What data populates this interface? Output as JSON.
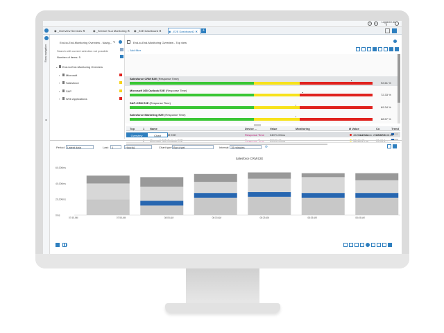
{
  "app": {
    "user_label": "Logged in as",
    "user_name": "ti"
  },
  "tabs": [
    {
      "label": "_Overview Services"
    },
    {
      "label": "_Service SLA Monitoring"
    },
    {
      "label": "_E2E Dashboard"
    },
    {
      "label": "_E2E Dashboard2"
    }
  ],
  "sidebar": {
    "title": "End-to-End-Monitoring Overview - Navig...",
    "search_placeholder": "Search with current selection not possible",
    "items_label": "Number of items:",
    "items_count": "5",
    "tree": [
      {
        "label": "End-to-End-Monitoring Overview",
        "color": ""
      },
      {
        "label": "Microsoft",
        "color": "#e0221e"
      },
      {
        "label": "Salesforce",
        "color": "#f7d21a"
      },
      {
        "label": "SAP",
        "color": "#f7d21a"
      },
      {
        "label": "Web Applications",
        "color": "#e0221e"
      }
    ],
    "side_label": "Show navigation"
  },
  "main": {
    "title": "End-to-End-Monitoring Overview - Top view",
    "add_filter": "Add filter",
    "kpis": [
      {
        "name": "Salesforce CRM E2E",
        "metric": "(Response Time)",
        "value": "92.61 %",
        "fill": 0.92
      },
      {
        "name": "Microsoft 365 Outlook E2E",
        "metric": "(Response Time)",
        "value": "72.33 %",
        "fill": 0.72
      },
      {
        "name": "SAP-CRM E2E",
        "metric": "(Response Time)",
        "value": "69.34 %",
        "fill": 0.69
      },
      {
        "name": "Salesforce Marketing E2E",
        "metric": "(Response Time)",
        "value": "68.57 %",
        "fill": 0.69
      }
    ],
    "table": {
      "headers": [
        "Top",
        "1",
        "Name",
        "Device ...",
        "Value",
        "Monitoring",
        "Ø Value",
        "Co",
        "Trend"
      ],
      "rows": [
        {
          "top": "1",
          "name": "Salesforce CRM E2E",
          "device": "Response Time",
          "value": "34071.00ms",
          "avg": "46203.47ms",
          "co": "03:47:1..."
        },
        {
          "top": "2",
          "name": "Microsoft 365 Outlook E2E",
          "device": "Response Time",
          "value": "35920.00ms",
          "avg": "36116.67ms",
          "co": "03:43:4..."
        }
      ]
    },
    "view_tabs": [
      "Overview",
      "Chart"
    ],
    "last_refresh": "Last refresh: 2022/04/29 08:45"
  },
  "chart_toolbar": {
    "period_label": "Period:",
    "period_value": "Latest data",
    "last_label": "Last:",
    "last_value": "1",
    "unit_value": "Hour(s)",
    "type_label": "Chart type:",
    "type_value": "Bar chart",
    "interval_label": "Interval:",
    "interval_value": "15 minutes"
  },
  "chart_data": {
    "type": "bar",
    "title": "Salesforce CRM E2E",
    "ylabel": "",
    "xlabel": "",
    "y_ticks": [
      "60,000ms",
      "40,000ms",
      "20,000ms",
      "0ms"
    ],
    "x_ticks": [
      "07:45 AM",
      "07:55 AM",
      "08:05 AM",
      "08:15 AM",
      "08:25 AM",
      "08:35 AM",
      "08:45 AM"
    ],
    "ylim": [
      0,
      65000
    ],
    "categories": [
      "07:45",
      "08:00",
      "08:15",
      "08:30",
      "08:45",
      "09:00"
    ],
    "series": [
      {
        "values": [
          20000,
          12000,
          22000,
          23000,
          22000,
          22000
        ]
      },
      {
        "values": [
          0,
          6000,
          6000,
          6000,
          6000,
          6000
        ]
      },
      {
        "values": [
          40000,
          36000,
          42000,
          46000,
          48000,
          44000
        ]
      },
      {
        "values": [
          50000,
          48000,
          52000,
          54000,
          53000,
          53000
        ]
      }
    ],
    "colors": {
      "light": "#c8c8c8",
      "blue": "#2766b0",
      "mid": "#d7d7d7",
      "dark": "#999999"
    }
  },
  "colors": {
    "accent": "#1a6fb5",
    "green": "#39c634",
    "yellow": "#f7e21a",
    "red": "#e0221e",
    "magenta": "#c01874"
  }
}
